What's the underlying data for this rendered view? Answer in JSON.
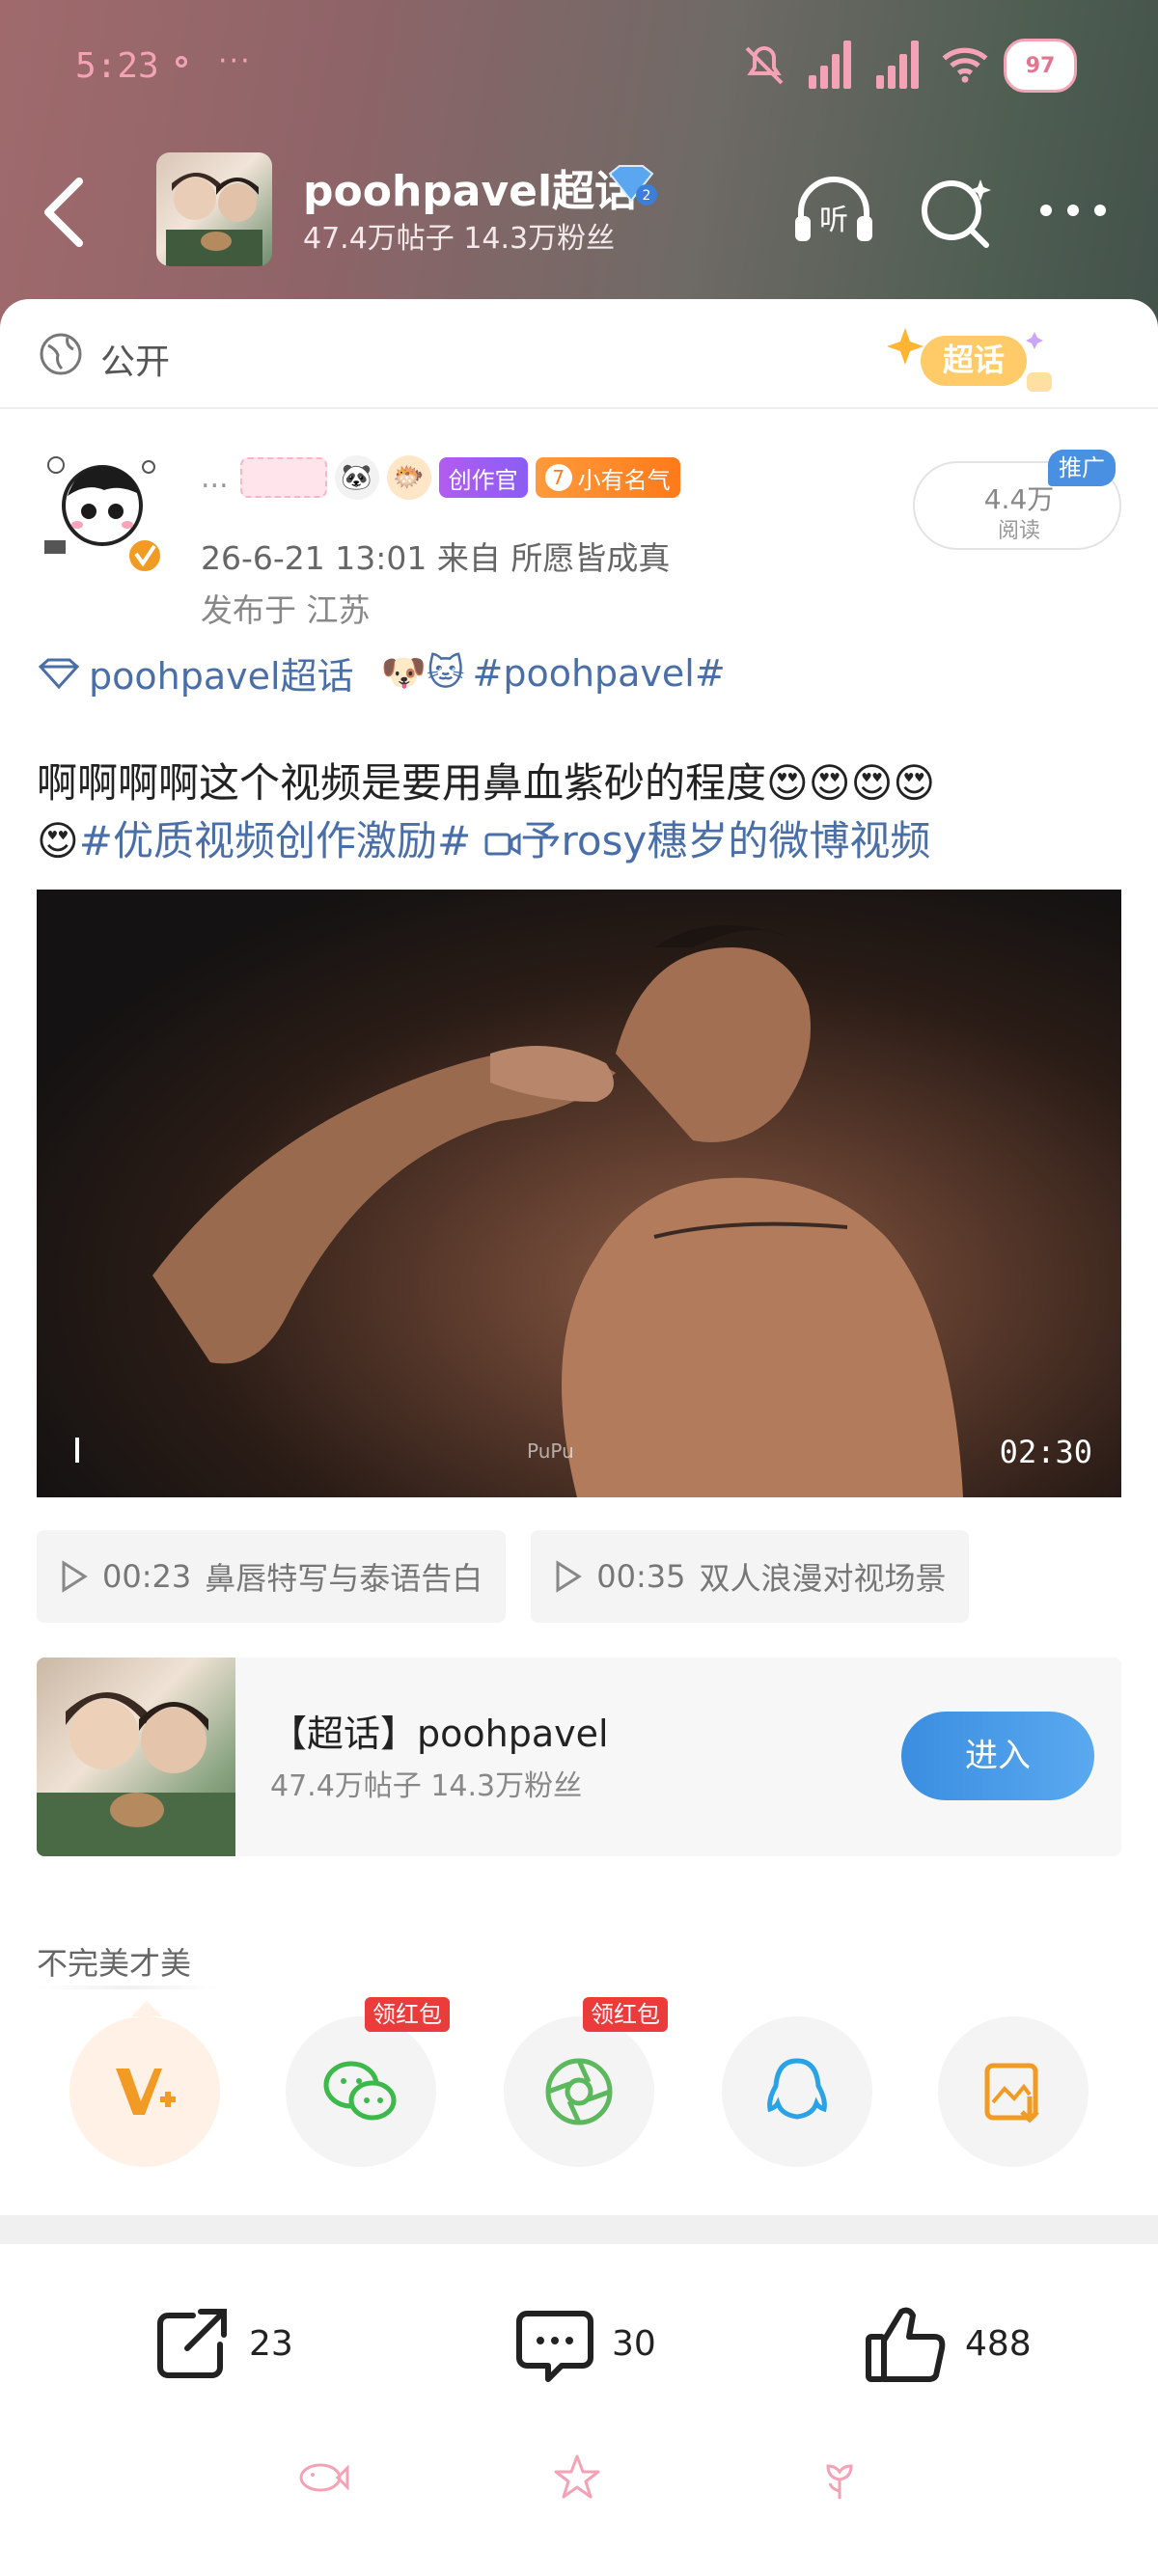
{
  "status_bar": {
    "time": "5:23",
    "more": "···",
    "battery": "97"
  },
  "header": {
    "title": "poohpavel超话",
    "level_badge": "2",
    "stats": "47.4万帖子  14.3万粉丝",
    "listen_label": "听"
  },
  "visibility": {
    "label": "公开",
    "stamp": "超话"
  },
  "author": {
    "ellipsis": "...",
    "badges": {
      "creator": "创作官",
      "fame_level": "7",
      "fame": "小有名气"
    },
    "time_line": "26-6-21 13:01  来自 所愿皆成真",
    "location_line": "发布于 江苏",
    "reads": "4.4万",
    "reads_label": "阅读",
    "promo": "推广"
  },
  "post": {
    "topic": "poohpavel超话",
    "topic_emoji": "🐶🐱",
    "topic_tag": "#poohpavel#",
    "line1": "啊啊啊啊这个视频是要用鼻血紫砂的程度😍😍😍😍",
    "line2_emoji": "😍",
    "hashtag": "#优质视频创作激励#",
    "video_link": "予rosy穗岁的微博视频"
  },
  "video": {
    "duration": "02:30",
    "watermark": "PuPu"
  },
  "chapters": [
    {
      "time": "00:23",
      "label": "鼻唇特写与泰语告白"
    },
    {
      "time": "00:35",
      "label": "双人浪漫对视场景"
    }
  ],
  "topic_card": {
    "title": "【超话】poohpavel",
    "stats": "47.4万帖子  14.3万粉丝",
    "enter": "进入"
  },
  "tagline": "不完美才美",
  "share": {
    "red_packet_label": "领红包"
  },
  "actions": {
    "reposts": "23",
    "comments": "30",
    "likes": "488"
  },
  "colors": {
    "accent_blue": "#4a6fa8",
    "status_pink": "#f4a3b6",
    "enter_button": "#3a8ee0",
    "red_packet": "#ec3b3b"
  }
}
